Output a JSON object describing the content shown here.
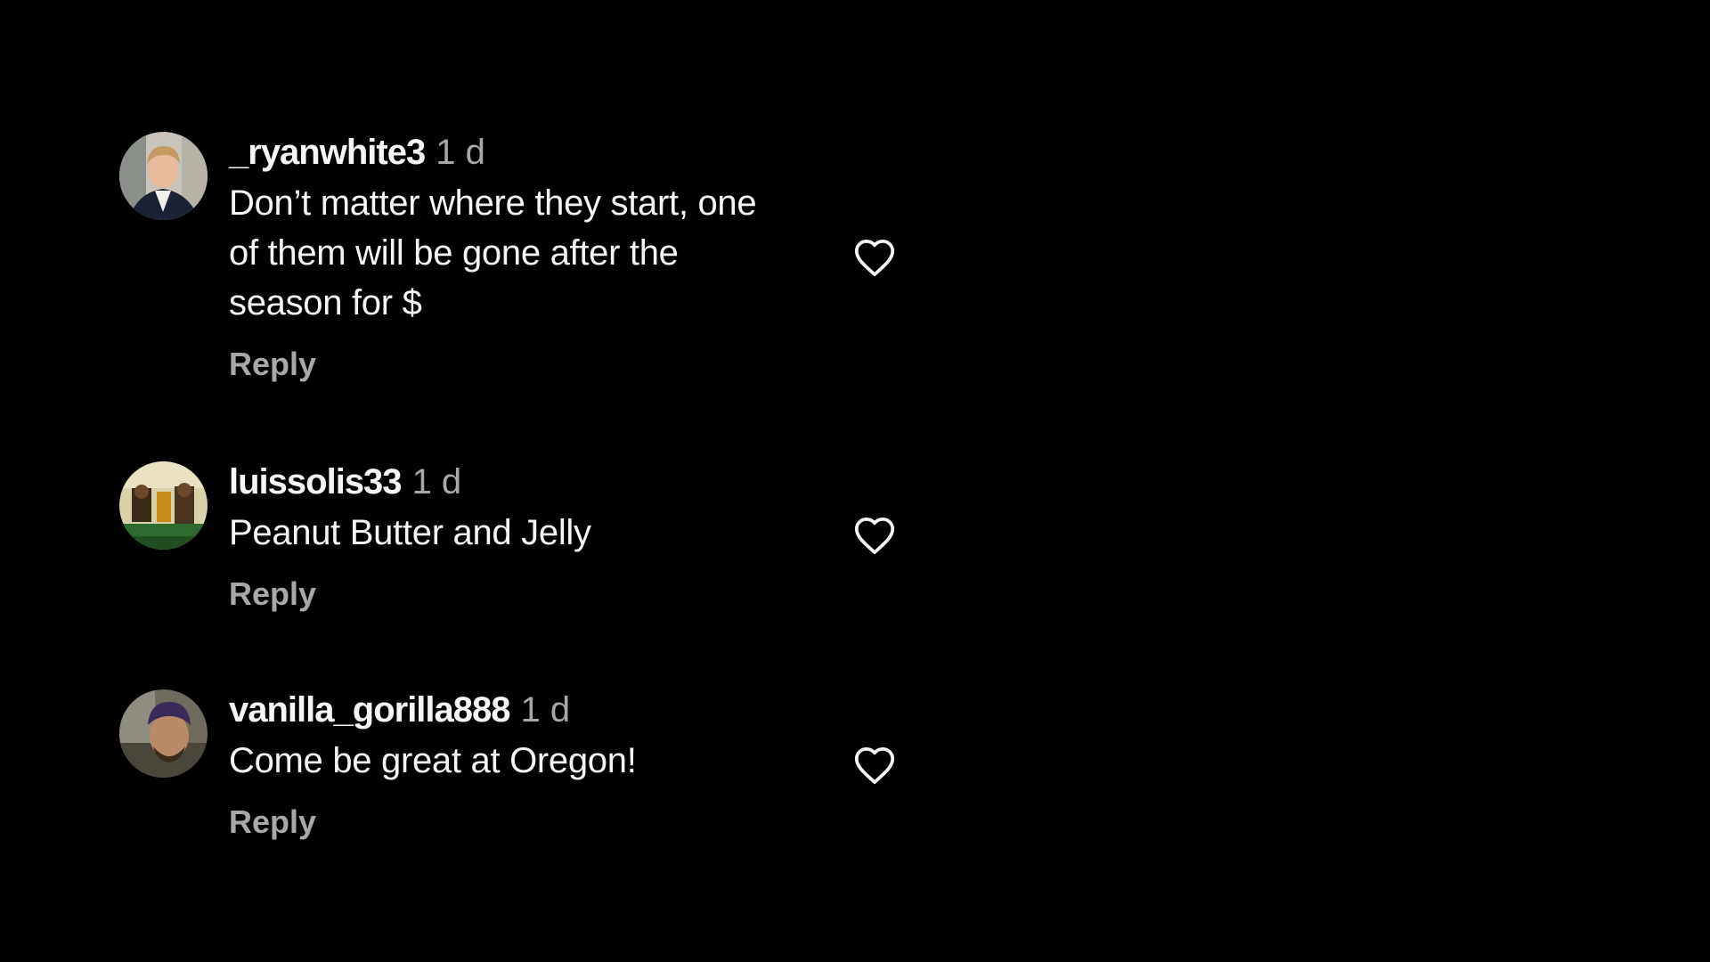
{
  "comments": [
    {
      "username": "_ryanwhite3",
      "age": "1 d",
      "text": "Don’t matter where they start, one of them will be gone after the season for $",
      "reply_label": "Reply",
      "avatar_icon": "user-photo-avatar",
      "like_icon": "heart-outline-icon"
    },
    {
      "username": "luissolis33",
      "age": "1 d",
      "text": "Peanut Butter and Jelly",
      "reply_label": "Reply",
      "avatar_icon": "user-photo-avatar",
      "like_icon": "heart-outline-icon"
    },
    {
      "username": "vanilla_gorilla888",
      "age": "1 d",
      "text": "Come be great at Oregon!",
      "reply_label": "Reply",
      "avatar_icon": "user-photo-avatar",
      "like_icon": "heart-outline-icon"
    }
  ],
  "colors": {
    "background": "#000000",
    "primary_text": "#f5f5f5",
    "secondary_text": "#a8a8a8"
  }
}
